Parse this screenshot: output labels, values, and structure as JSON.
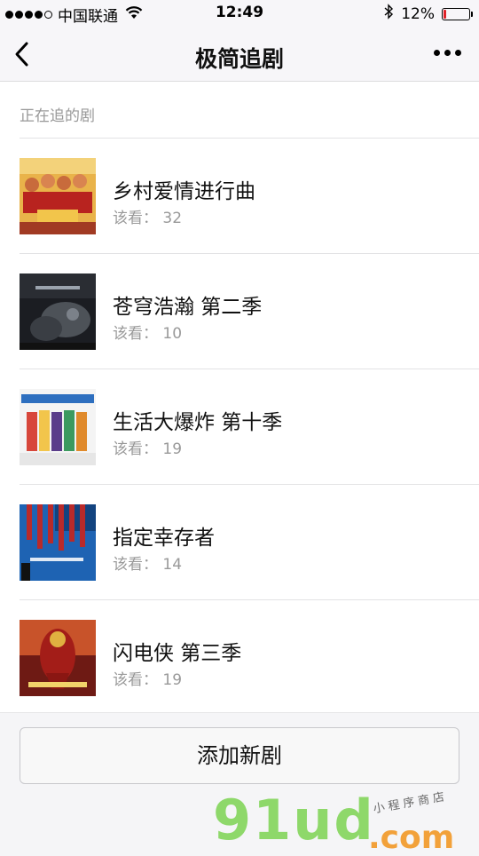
{
  "status_bar": {
    "carrier": "中国联通",
    "time": "12:49",
    "battery": "12%",
    "battery_level": 0.12,
    "battery_color": "#e0222a"
  },
  "nav": {
    "title": "极简追剧",
    "back_icon": "chevron-left-icon",
    "more_icon": "more-dots-icon"
  },
  "section": {
    "label": "正在追的剧"
  },
  "shows": [
    {
      "title": "乡村爱情进行曲",
      "sub_label": "该看：",
      "episode": "32"
    },
    {
      "title": "苍穹浩瀚 第二季",
      "sub_label": "该看：",
      "episode": "10"
    },
    {
      "title": "生活大爆炸 第十季",
      "sub_label": "该看：",
      "episode": "19"
    },
    {
      "title": "指定幸存者",
      "sub_label": "该看：",
      "episode": "14"
    },
    {
      "title": "闪电侠 第三季",
      "sub_label": "该看：",
      "episode": "19"
    }
  ],
  "footer": {
    "add_button": "添加新剧"
  },
  "watermark": {
    "brand": "91ud",
    "domain": ".com",
    "tagline": "小程序商店"
  }
}
